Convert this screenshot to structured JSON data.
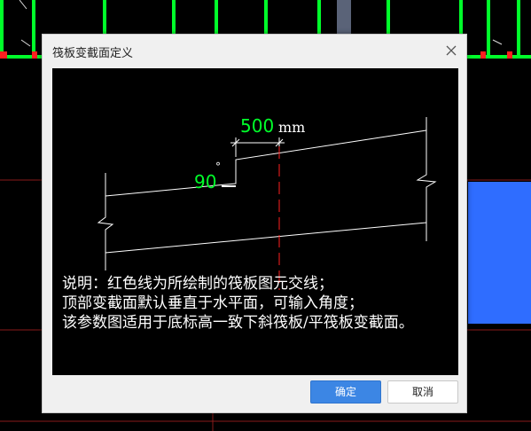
{
  "dialog": {
    "title": "筏板变截面定义",
    "preview": {
      "dimension_value": "500",
      "dimension_unit": "mm",
      "angle_value": "90",
      "angle_symbol": "°"
    },
    "notes": [
      "说明：红色线为所绘制的筏板图元交线；",
      "顶部变截面默认垂直于水平面，可输入角度；",
      "该参数图适用于底标高一致下斜筏板/平筏板变截面。"
    ],
    "ok_label": "确定",
    "cancel_label": "取消"
  },
  "colors": {
    "cad_green": "#00ff2a",
    "cad_red": "#ff1f1f",
    "cad_blue": "#2f6dff",
    "ok_button": "#3c86e4"
  },
  "icons": [
    "close-icon"
  ]
}
